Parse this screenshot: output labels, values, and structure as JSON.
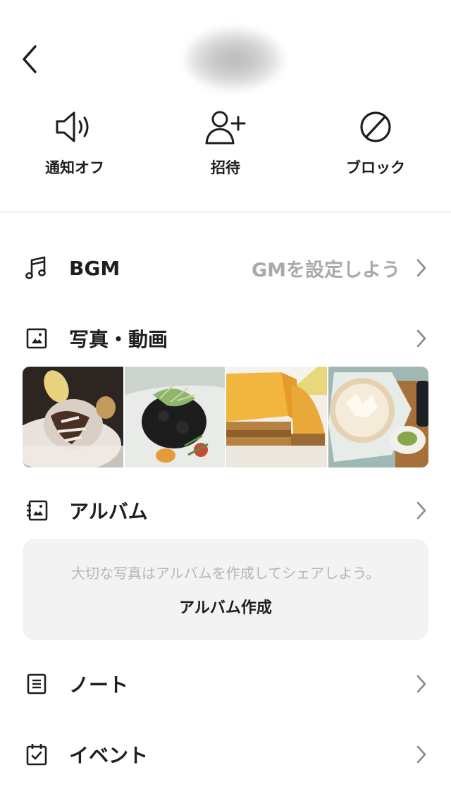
{
  "header": {
    "back_icon": "chevron-left-icon"
  },
  "actions": [
    {
      "label": "通知オフ",
      "icon": "speaker-icon"
    },
    {
      "label": "招待",
      "icon": "add-person-icon"
    },
    {
      "label": "ブロック",
      "icon": "block-icon"
    }
  ],
  "rows": {
    "bgm": {
      "label": "BGM",
      "value": "BGMを設定しよう",
      "icon": "music-note-icon"
    },
    "photos": {
      "label": "写真・動画",
      "icon": "photo-icon"
    },
    "album": {
      "label": "アルバム",
      "icon": "album-icon"
    },
    "note": {
      "label": "ノート",
      "icon": "note-icon"
    },
    "event": {
      "label": "イベント",
      "icon": "calendar-check-icon"
    }
  },
  "photos": [
    {
      "name": "dessert-photo"
    },
    {
      "name": "squid-ink-dish-photo"
    },
    {
      "name": "sandwich-photo"
    },
    {
      "name": "gratin-plate-photo"
    }
  ],
  "album_card": {
    "hint": "大切な写真はアルバムを作成してシェアしよう。",
    "create_label": "アルバム作成"
  },
  "colors": {
    "text": "#1e1e1e",
    "muted": "#a9a9a9",
    "card_bg": "#f3f3f3"
  }
}
